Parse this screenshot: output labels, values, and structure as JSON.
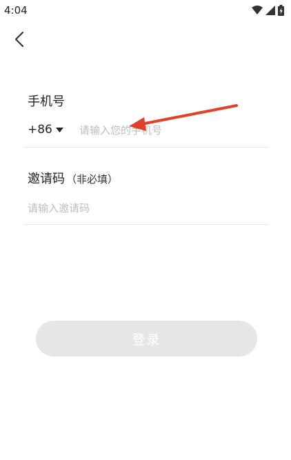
{
  "status_bar": {
    "time": "4:04"
  },
  "form": {
    "phone_label": "手机号",
    "country_code": "+86",
    "phone_placeholder": "请输入您的手机号",
    "invite_label": "邀请码",
    "invite_optional": "（非必填）",
    "invite_placeholder": "请输入邀请码"
  },
  "login_button": {
    "label": "登录"
  },
  "colors": {
    "annotation_arrow": "#e3402b",
    "button_bg": "#e6e6e6"
  }
}
